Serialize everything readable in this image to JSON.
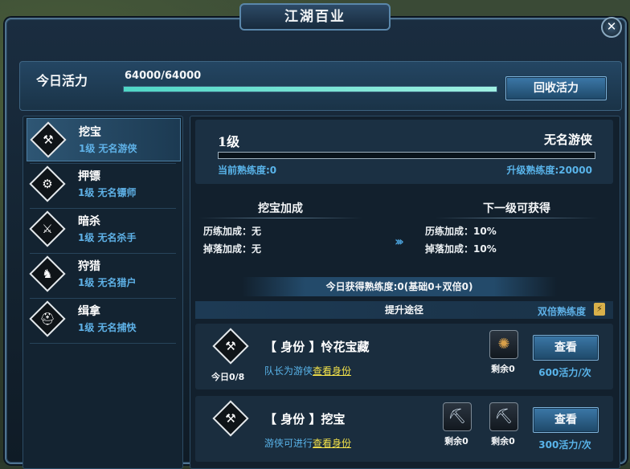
{
  "window": {
    "title": "江湖百业",
    "close_glyph": "✕"
  },
  "vitality": {
    "label": "今日活力",
    "value_text": "64000/64000",
    "fraction": 1.0,
    "recycle_button": "回收活力"
  },
  "jobs": [
    {
      "name": "挖宝",
      "level": "1级 无名游侠",
      "icon": "shovel-icon",
      "glyph": "⚒",
      "active": true
    },
    {
      "name": "押镖",
      "level": "1级 无名镖师",
      "icon": "escort-icon",
      "glyph": "⚙",
      "active": false
    },
    {
      "name": "暗杀",
      "level": "1级 无名杀手",
      "icon": "crossed-blades-icon",
      "glyph": "⚔",
      "active": false
    },
    {
      "name": "狩猎",
      "level": "1级 无名猎户",
      "icon": "deer-icon",
      "glyph": "♞",
      "active": false
    },
    {
      "name": "缉拿",
      "level": "1级 无名捕快",
      "icon": "helmet-icon",
      "glyph": "⛑",
      "active": false
    }
  ],
  "detail": {
    "level": "1级",
    "title": "无名游侠",
    "current_exp": "当前熟练度:0",
    "next_exp": "升级熟练度:20000",
    "exp_fraction": 0.0,
    "bonus_title": "挖宝加成",
    "bonus_rows": [
      "历练加成：无",
      "掉落加成：无"
    ],
    "next_title": "下一级可获得",
    "next_rows": [
      "历练加成：10%",
      "掉落加成：10%"
    ],
    "today_exp": "今日获得熟练度:0(基础0+双倍0)",
    "ways_title": "提升途径",
    "double_label": "双倍熟练度",
    "double_icon_glyph": "⚡"
  },
  "ways": [
    {
      "title": "【 身份 】怜花宝藏",
      "count": "今日0/8",
      "desc_prefix": "队长为游侠",
      "link": "查看身份",
      "items": [
        {
          "icon": "bronze-mirror-icon",
          "glyph": "✺",
          "remain": "剩余0"
        }
      ],
      "button": "查看",
      "cost": "600活力/次"
    },
    {
      "title": "【 身份 】挖宝",
      "count": "",
      "desc_prefix": "游侠可进行",
      "link": "查看身份",
      "items": [
        {
          "icon": "shovel-item-icon",
          "glyph": "⛏",
          "remain": "剩余0"
        },
        {
          "icon": "shovel-item-icon",
          "glyph": "⛏",
          "remain": "剩余0"
        }
      ],
      "button": "查看",
      "cost": "300活力/次"
    }
  ],
  "colors": {
    "accent": "#59b4ea",
    "link": "#f3e24a",
    "bar_fill": "#4fd6c6"
  }
}
